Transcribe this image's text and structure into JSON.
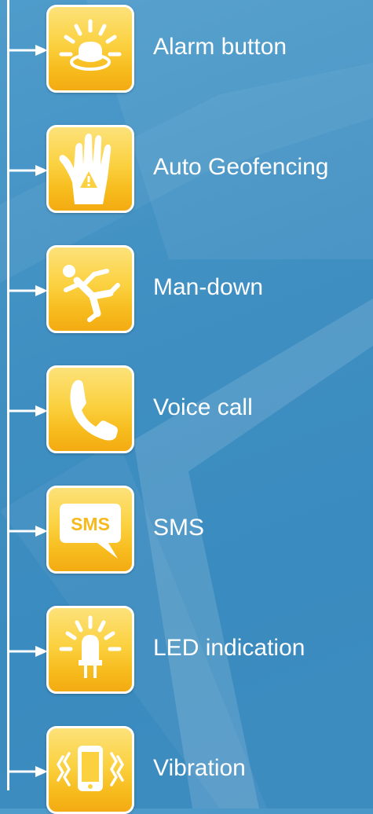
{
  "features": [
    {
      "label": "Alarm button",
      "icon": "alarm-button-icon"
    },
    {
      "label": "Auto Geofencing",
      "icon": "geofence-hand-icon"
    },
    {
      "label": "Man-down",
      "icon": "man-down-icon"
    },
    {
      "label": "Voice call",
      "icon": "phone-icon"
    },
    {
      "label": "SMS",
      "icon": "sms-bubble-icon",
      "badge": "SMS"
    },
    {
      "label": "LED indication",
      "icon": "led-icon"
    },
    {
      "label": "Vibration",
      "icon": "vibrating-phone-icon"
    }
  ],
  "colors": {
    "background": "#3f8fc2",
    "tile": "#fbd140",
    "line": "#ffffff"
  }
}
